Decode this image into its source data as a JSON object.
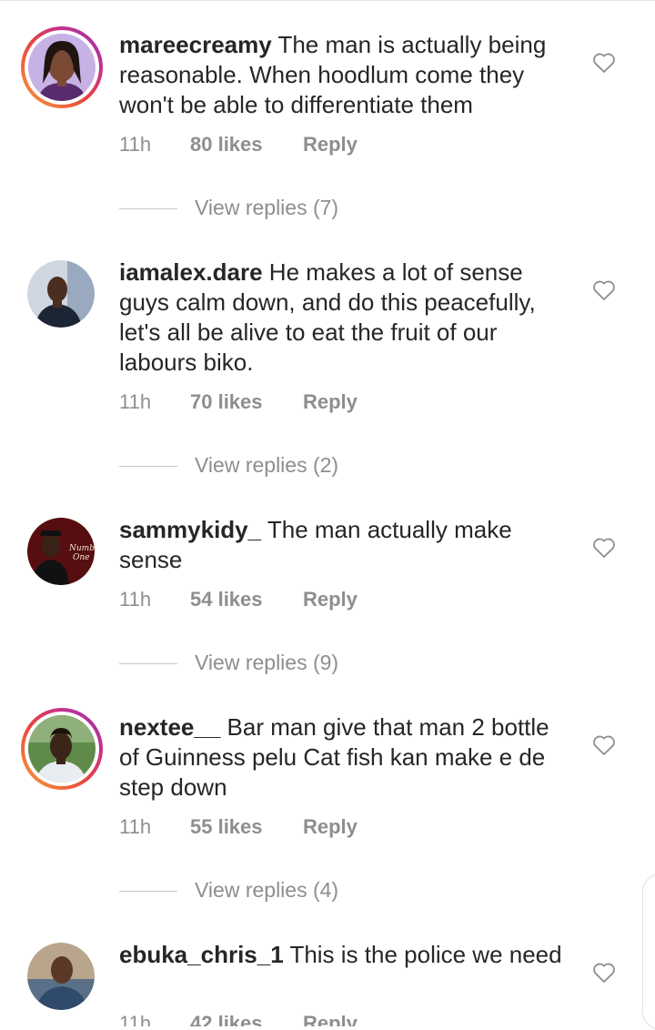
{
  "comments": [
    {
      "username": "mareecreamy",
      "text": "The man is actually being reasonable. When hoodlum come they won't be able to differentiate them",
      "time": "11h",
      "likes": "80 likes",
      "reply": "Reply",
      "view_replies": "View replies (7)",
      "has_story_ring": true
    },
    {
      "username": "iamalex.dare",
      "text": "He makes a lot of sense guys calm down, and do this peacefully, let's all be alive to eat the fruit of our labours biko.",
      "time": "11h",
      "likes": "70 likes",
      "reply": "Reply",
      "view_replies": "View replies (2)",
      "has_story_ring": false
    },
    {
      "username": "sammykidy_",
      "text": "The man actually make sense",
      "time": "11h",
      "likes": "54 likes",
      "reply": "Reply",
      "view_replies": "View replies (9)",
      "has_story_ring": false
    },
    {
      "username": "nextee__",
      "text": "Bar man give that man 2 bottle of Guinness pelu Cat fish kan make e de step down",
      "time": "11h",
      "likes": "55 likes",
      "reply": "Reply",
      "view_replies": "View replies (4)",
      "has_story_ring": true
    },
    {
      "username": "ebuka_chris_1",
      "text": "This is the police we need",
      "time": "11h",
      "likes": "42 likes",
      "reply": "Reply",
      "has_story_ring": false
    }
  ],
  "icons": {
    "like": "heart-outline-icon"
  },
  "colors": {
    "text": "#262626",
    "secondary": "#8e8e8e",
    "divider": "#c7c7c7"
  }
}
